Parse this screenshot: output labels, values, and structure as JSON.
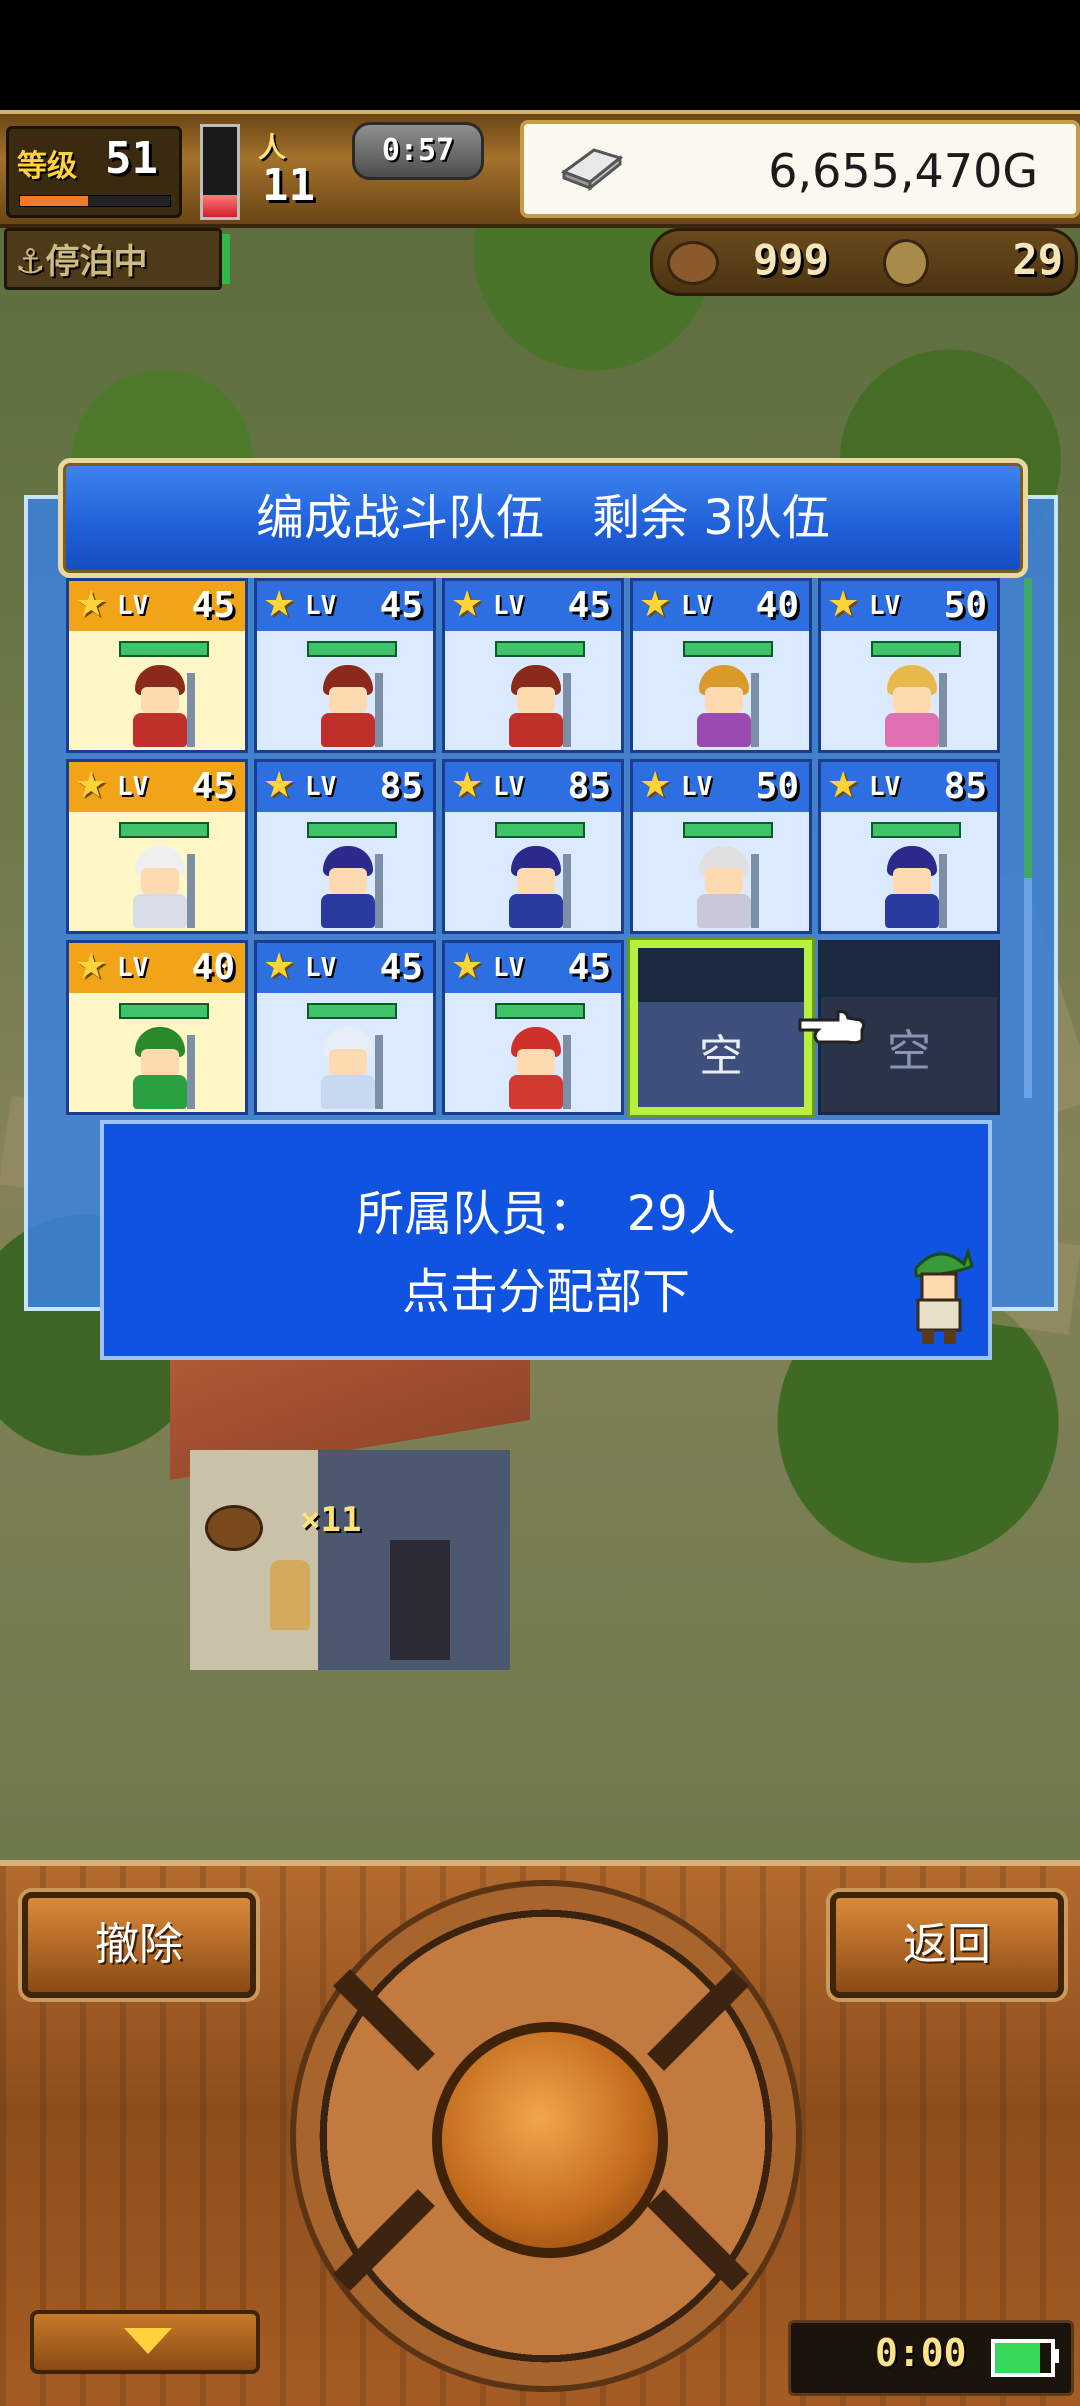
{
  "hud": {
    "level_label": "等级",
    "level": "51",
    "crew_label": "人",
    "crew_count": "11",
    "timer": "0:57",
    "gold": "6,655,470G",
    "anchor_status": "停泊中",
    "food": "999",
    "ore": "29",
    "stamina_fraction": 0.25,
    "exp_fraction": 0.45
  },
  "dialog": {
    "title": "编成战斗队伍　剩余 3队伍",
    "lv_label": "LV",
    "slots": [
      {
        "level": "45",
        "highlight": true,
        "hair": "#8a2a1a",
        "body": "#c0302a"
      },
      {
        "level": "45",
        "highlight": false,
        "hair": "#8a2a1a",
        "body": "#c0302a"
      },
      {
        "level": "45",
        "highlight": false,
        "hair": "#8a2a1a",
        "body": "#c0302a"
      },
      {
        "level": "40",
        "highlight": false,
        "hair": "#d99a2a",
        "body": "#9a4ab0"
      },
      {
        "level": "50",
        "highlight": false,
        "hair": "#e8b84a",
        "body": "#e070b0"
      },
      {
        "level": "45",
        "highlight": true,
        "hair": "#f0f0f0",
        "body": "#d8dde8"
      },
      {
        "level": "85",
        "highlight": false,
        "hair": "#2a2a8a",
        "body": "#2a3aa0"
      },
      {
        "level": "85",
        "highlight": false,
        "hair": "#2a2a8a",
        "body": "#2a3aa0"
      },
      {
        "level": "50",
        "highlight": false,
        "hair": "#e0e0e0",
        "body": "#c8c8d8"
      },
      {
        "level": "85",
        "highlight": false,
        "hair": "#2a2a8a",
        "body": "#2a3aa0"
      },
      {
        "level": "40",
        "highlight": true,
        "hair": "#2a8a2a",
        "body": "#2aa040"
      },
      {
        "level": "45",
        "highlight": false,
        "hair": "#e8eef8",
        "body": "#c8d8f0"
      },
      {
        "level": "45",
        "highlight": false,
        "hair": "#d0302a",
        "body": "#d03a30"
      }
    ],
    "empty_label": "空",
    "info_members_label": "所属队员：",
    "info_members_count": "29人",
    "info_hint": "点击分配部下"
  },
  "controls": {
    "remove_label": "撤除",
    "back_label": "返回",
    "clock": "0:00",
    "battery_fraction": 0.8
  },
  "shop_count": "×11",
  "colors": {
    "accent_blue": "#1053e0",
    "select_green": "#b7f040",
    "gold_text": "#ffd23e"
  }
}
